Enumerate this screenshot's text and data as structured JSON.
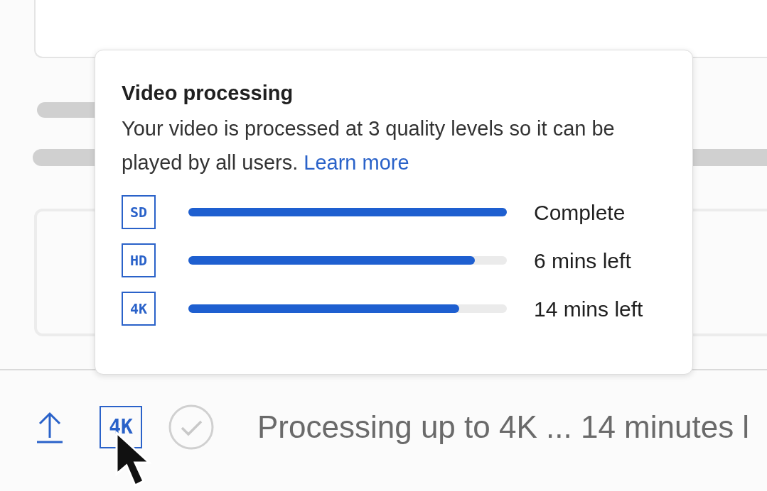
{
  "tooltip": {
    "title": "Video processing",
    "body": "Your video is processed at 3 quality levels so it can be played by all users.",
    "link": "Learn more",
    "rows": [
      {
        "badge": "SD",
        "level": 1.0,
        "status": "Complete"
      },
      {
        "badge": "HD",
        "level": 0.9,
        "status": "6 mins left"
      },
      {
        "badge": "4K",
        "level": 0.85,
        "status": "14 mins left"
      }
    ]
  },
  "status_bar": {
    "badge": "4K",
    "text": "Processing up to 4K ... 14 minutes l"
  }
}
